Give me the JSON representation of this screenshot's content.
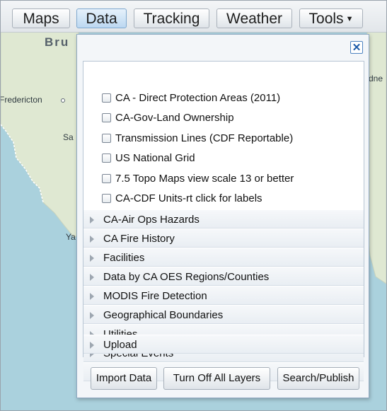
{
  "toolbar": {
    "tabs": [
      {
        "label": "Maps"
      },
      {
        "label": "Data"
      },
      {
        "label": "Tracking"
      },
      {
        "label": "Weather"
      },
      {
        "label": "Tools"
      }
    ]
  },
  "map": {
    "labels": {
      "bru": "Bru",
      "fredericton": "Fredericton",
      "sa": "Sa",
      "ya": "Ya",
      "edge": "dne"
    }
  },
  "panel": {
    "close_label": "✕",
    "checkboxes": [
      {
        "label": "CA - Direct Protection Areas (2011)",
        "checked": false
      },
      {
        "label": "CA-Gov-Land Ownership",
        "checked": false
      },
      {
        "label": "Transmission Lines (CDF Reportable)",
        "checked": false
      },
      {
        "label": "US National Grid",
        "checked": false
      },
      {
        "label": "7.5 Topo Maps view scale 13 or better",
        "checked": false
      },
      {
        "label": "CA-CDF Units-rt click for labels",
        "checked": false
      }
    ],
    "folders": [
      {
        "label": "CA-Air Ops Hazards"
      },
      {
        "label": "CA Fire History"
      },
      {
        "label": "Facilities"
      },
      {
        "label": "Data by CA OES Regions/Counties"
      },
      {
        "label": "MODIS Fire Detection"
      },
      {
        "label": "Geographical Boundaries"
      },
      {
        "label": "Utilities"
      },
      {
        "label": "Special Events"
      },
      {
        "label": "Upload"
      }
    ],
    "buttons": {
      "import": "Import Data",
      "turn_off": "Turn Off All Layers",
      "search": "Search/Publish"
    }
  },
  "colors": {
    "water": "#aad1dd",
    "land": "#dfe8d2",
    "active_tab": "#bcd8f1",
    "panel_border": "#8fa9c2"
  }
}
